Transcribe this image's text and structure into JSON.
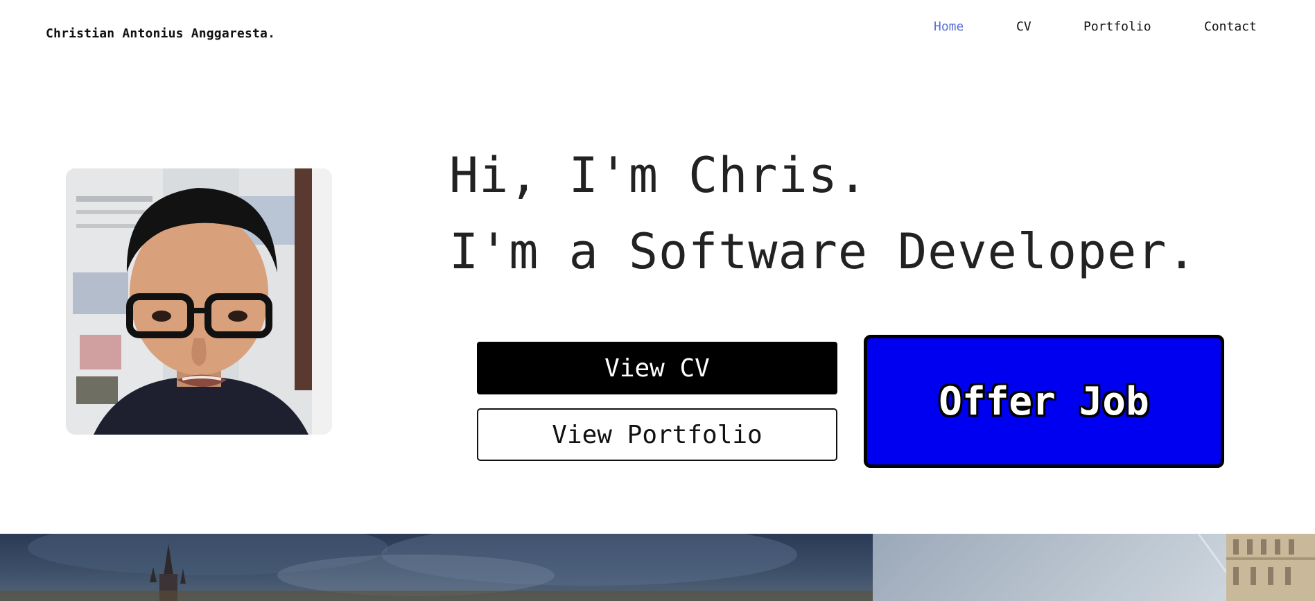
{
  "brand": "Christian Antonius Anggaresta.",
  "nav": {
    "home": "Home",
    "cv": "CV",
    "portfolio": "Portfolio",
    "contact": "Contact",
    "active_color": "#5a6fd8"
  },
  "hero": {
    "greeting": "Hi, I'm Chris.",
    "role": "I'm a Software Developer.",
    "buttons": {
      "view_cv": "View CV",
      "view_portfolio": "View Portfolio",
      "offer_job": "Offer Job"
    },
    "offer_color": "#0000f0"
  }
}
